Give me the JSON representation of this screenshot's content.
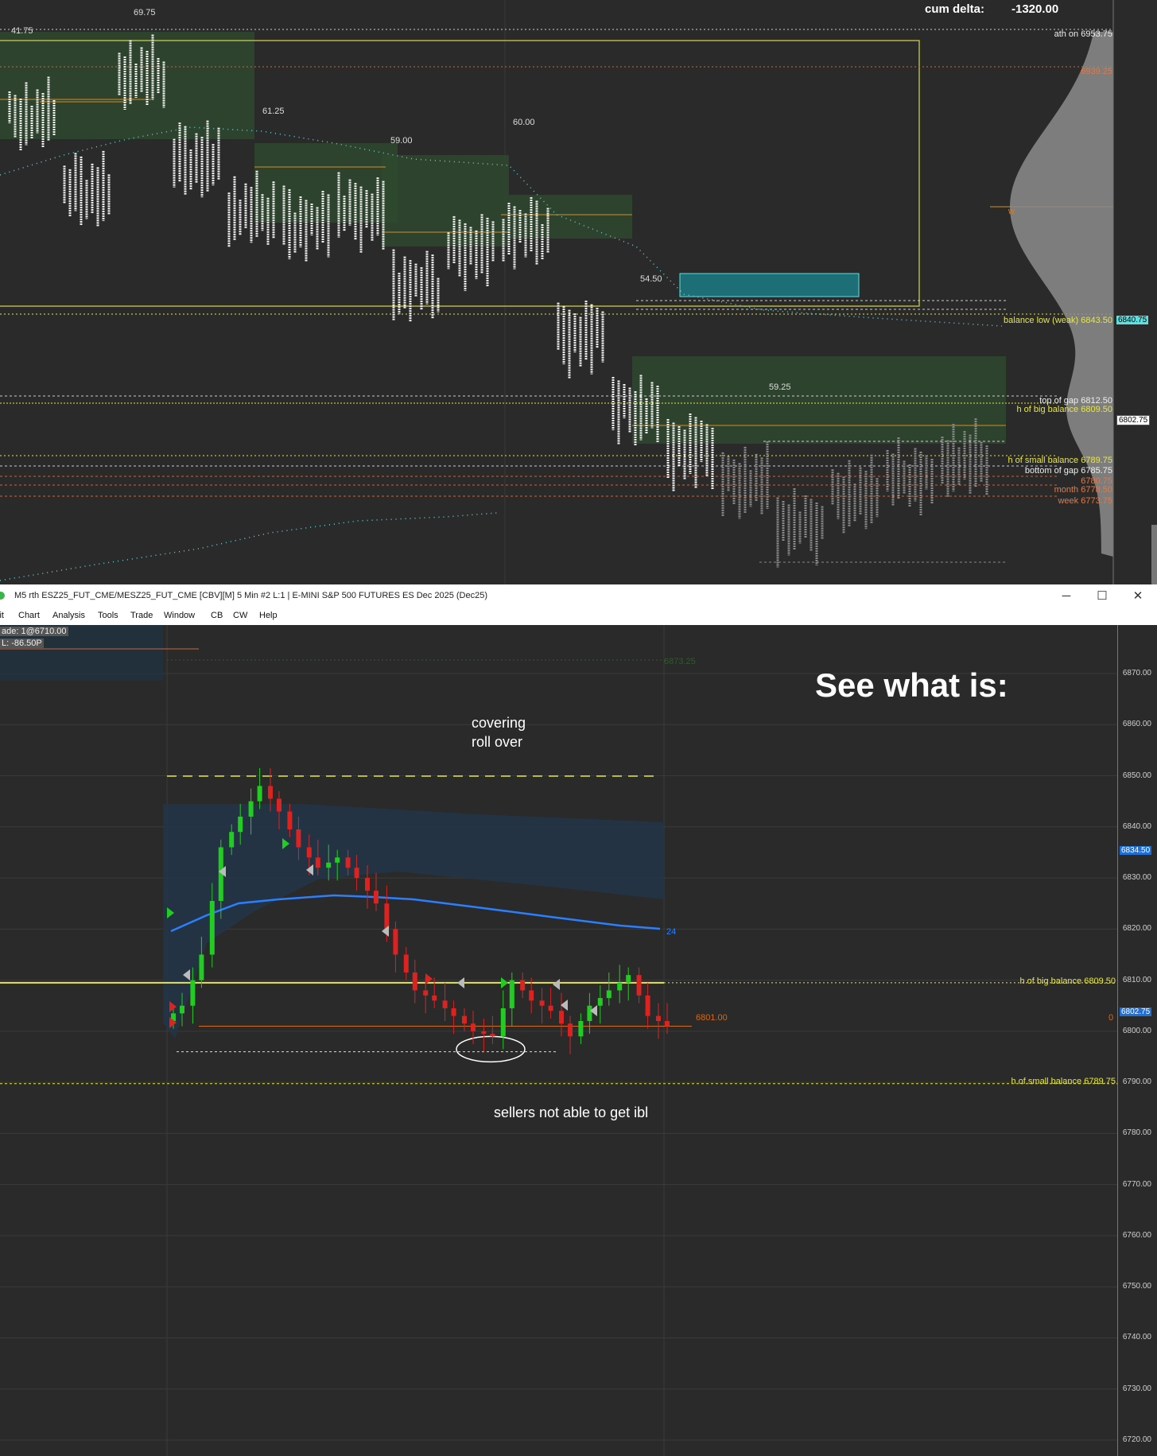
{
  "top_chart": {
    "cum_delta_label": "cum delta:",
    "cum_delta_value": "-1320.00",
    "value_labels": [
      "41.75",
      "69.75",
      "61.25",
      "59.00",
      "60.00",
      "54.50",
      "59.25"
    ],
    "levels": [
      {
        "label": "ath on",
        "value": "6953.75"
      },
      {
        "label": "",
        "value": "6939.25"
      },
      {
        "label": "balance low (weak)",
        "value": "6843.50"
      },
      {
        "label": "top of gap",
        "value": "6812.50"
      },
      {
        "label": "h of big balance",
        "value": "6809.50"
      },
      {
        "label": "h of small balance",
        "value": "6789.75"
      },
      {
        "label": "bottom of gap",
        "value": "6785.75"
      },
      {
        "label": "",
        "value": "6780.75"
      },
      {
        "label": "month",
        "value": "6778.50"
      },
      {
        "label": "week",
        "value": "6773.75"
      }
    ],
    "price_tags": [
      "6840.75",
      "6802.75"
    ],
    "poc_marker": "w"
  },
  "window": {
    "title": "M5 rth ESZ25_FUT_CME/MESZ25_FUT_CME [CBV][M]  5 Min  #2 L:1 | E-MINI S&P 500 FUTURES ES Dec 2025 (Dec25)",
    "minimize": "─",
    "maximize": "☐",
    "close": "✕"
  },
  "menu": [
    "lit",
    "Chart",
    "Analysis",
    "Tools",
    "Trade",
    "Window",
    "CB",
    "CW",
    "Help"
  ],
  "bottom_chart": {
    "trade_info": "ade: 1@6710.00",
    "pl_info": "L: -86.50P",
    "faint_level": "6873.25",
    "heading": "See what is:",
    "annotation_covering": "covering",
    "annotation_rollover": "roll over",
    "annotation_sellers": "sellers not able to get ibl",
    "vwap_label": "24",
    "orange_level": "6801.00",
    "zero_label": "0",
    "levels": [
      {
        "label": "h of big balance",
        "value": "6809.50"
      },
      {
        "label": "h of small balance",
        "value": "6789.75"
      }
    ],
    "price_tags": [
      "6834.50",
      "6802.75"
    ],
    "axis_ticks": [
      "6870.00",
      "6860.00",
      "6850.00",
      "6840.00",
      "6830.00",
      "6820.00",
      "6810.00",
      "6800.00",
      "6790.00",
      "6780.00",
      "6770.00",
      "6760.00",
      "6750.00",
      "6740.00",
      "6730.00",
      "6720.00"
    ]
  },
  "chart_data": [
    {
      "type": "line",
      "title": "",
      "ylim": [
        6760,
        6960
      ],
      "series": [
        {
          "values": [
            6920,
            6895,
            6934,
            6905,
            6887,
            6883,
            6888,
            6862,
            6875,
            6880,
            6845,
            6820,
            6806,
            6795,
            6780,
            6790,
            6797,
            6802
          ]
        }
      ]
    },
    {
      "type": "line",
      "title": "",
      "ylim": [
        6715,
        6875
      ],
      "series": [
        {
          "values": [
            6805,
            6815,
            6836,
            6842,
            6848,
            6843,
            6836,
            6832,
            6834,
            6830,
            6825,
            6815,
            6808,
            6806,
            6803,
            6800,
            6799,
            6810,
            6806,
            6804,
            6799,
            6805,
            6808,
            6811,
            6803,
            6801
          ]
        }
      ]
    }
  ]
}
